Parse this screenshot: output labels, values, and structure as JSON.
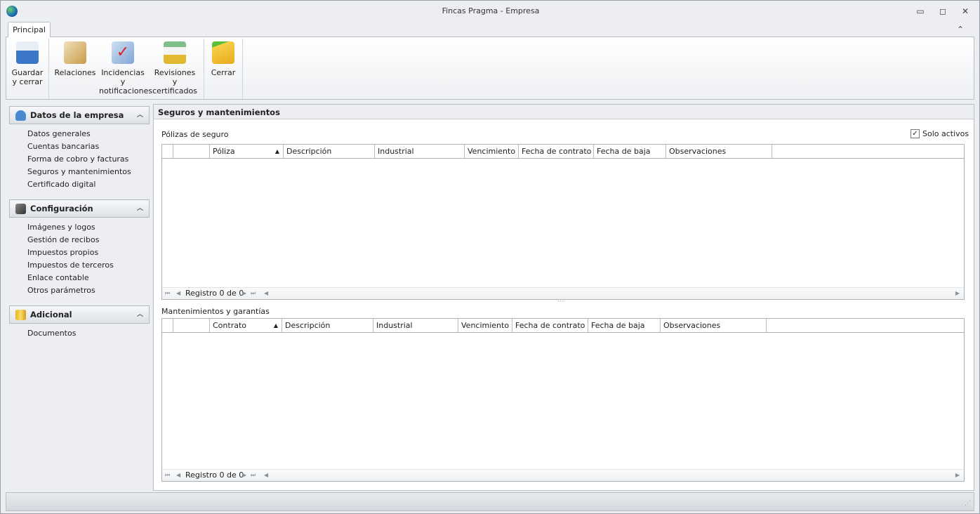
{
  "window": {
    "title": "Fincas Pragma - Empresa",
    "minimize": "▭",
    "maximize": "◻",
    "close": "✕",
    "collapse": "⌃"
  },
  "ribbon": {
    "tab": "Principal",
    "buttons": [
      {
        "label1": "Guardar",
        "label2": "y cerrar",
        "icon": "save-icon",
        "color": "#3b77c6"
      },
      {
        "label1": "Relaciones",
        "label2": "",
        "icon": "contacts-icon",
        "color": "#d9b878"
      },
      {
        "label1": "Incidencias y",
        "label2": "notificaciones",
        "icon": "notification-check-icon",
        "color": "#8fb3d9"
      },
      {
        "label1": "Revisiones y",
        "label2": "certificados",
        "icon": "document-bell-icon",
        "color": "#e2c340"
      },
      {
        "label1": "Cerrar",
        "label2": "",
        "icon": "folder-exit-icon",
        "color": "#f2c230"
      }
    ]
  },
  "sidebar": {
    "groups": [
      {
        "title": "Datos de la empresa",
        "icon": "user-icon",
        "items": [
          "Datos generales",
          "Cuentas bancarias",
          "Forma de cobro y facturas",
          "Seguros y mantenimientos",
          "Certificado digital"
        ]
      },
      {
        "title": "Configuración",
        "icon": "tools-icon",
        "items": [
          "Imágenes y logos",
          "Gestión de recibos",
          "Impuestos propios",
          "Impuestos de terceros",
          "Enlace contable",
          "Otros parámetros"
        ]
      },
      {
        "title": "Adicional",
        "icon": "database-icon",
        "items": [
          "Documentos"
        ]
      }
    ]
  },
  "panel": {
    "title": "Seguros y mantenimientos",
    "solo_activos": {
      "label": "Solo activos",
      "checked": true
    },
    "grid1": {
      "title": "Pólizas de seguro",
      "columns": [
        "",
        "",
        "Póliza",
        "Descripción",
        "Industrial",
        "Vencimiento",
        "Fecha de contrato",
        "Fecha de baja",
        "Observaciones"
      ],
      "footer": "Registro 0 de 0"
    },
    "grid2": {
      "title": "Mantenimientos y garantías",
      "columns": [
        "",
        "",
        "Contrato",
        "Descripción",
        "Industrial",
        "Vencimiento",
        "Fecha de contrato",
        "Fecha de baja",
        "Observaciones"
      ],
      "footer": "Registro 0 de 0"
    }
  }
}
